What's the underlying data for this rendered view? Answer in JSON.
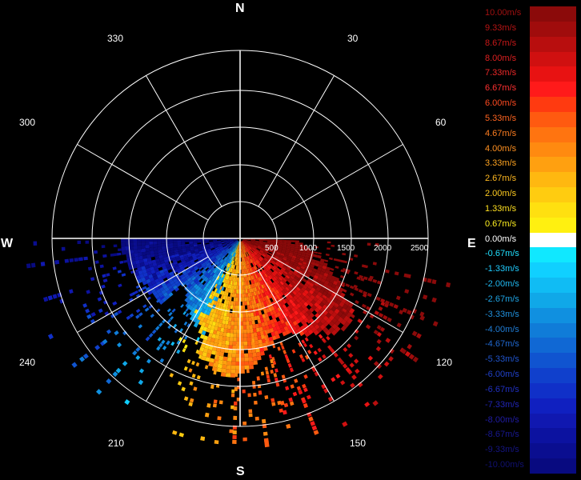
{
  "cardinals": {
    "north": "N",
    "south": "S",
    "east": "E",
    "west": "W"
  },
  "azimuth_labels": [
    "30",
    "60",
    "120",
    "150",
    "210",
    "240",
    "300",
    "330"
  ],
  "range_labels": [
    "500",
    "1000",
    "1500",
    "2000",
    "2500"
  ],
  "legend": [
    {
      "label": "10.00m/s",
      "color": "#8b0a0a",
      "text_color": "#a01010"
    },
    {
      "label": "9.33m/s",
      "color": "#a00c0c",
      "text_color": "#b81414"
    },
    {
      "label": "8.67m/s",
      "color": "#b80e0e",
      "text_color": "#c81818"
    },
    {
      "label": "8.00m/s",
      "color": "#d01010",
      "text_color": "#dd2020"
    },
    {
      "label": "7.33m/s",
      "color": "#e81212",
      "text_color": "#ee2828"
    },
    {
      "label": "6.67m/s",
      "color": "#ff1a1a",
      "text_color": "#ff3030"
    },
    {
      "label": "6.00m/s",
      "color": "#ff3a10",
      "text_color": "#ff4a20"
    },
    {
      "label": "5.33m/s",
      "color": "#ff5a10",
      "text_color": "#ff6420"
    },
    {
      "label": "4.67m/s",
      "color": "#ff7410",
      "text_color": "#ff7e20"
    },
    {
      "label": "4.00m/s",
      "color": "#ff8a10",
      "text_color": "#ff9020"
    },
    {
      "label": "3.33m/s",
      "color": "#ffa010",
      "text_color": "#ffa420"
    },
    {
      "label": "2.67m/s",
      "color": "#ffb810",
      "text_color": "#ffb820"
    },
    {
      "label": "2.00m/s",
      "color": "#ffcc10",
      "text_color": "#ffcc20"
    },
    {
      "label": "1.33m/s",
      "color": "#ffe010",
      "text_color": "#ffe020"
    },
    {
      "label": "0.67m/s",
      "color": "#fff010",
      "text_color": "#fff020"
    },
    {
      "label": "0.00m/s",
      "color": "#ffffff",
      "text_color": "#ffffff"
    },
    {
      "label": "-0.67m/s",
      "color": "#10e8ff",
      "text_color": "#20e0ff"
    },
    {
      "label": "-1.33m/s",
      "color": "#10d0ff",
      "text_color": "#20ccff"
    },
    {
      "label": "-2.00m/s",
      "color": "#10bcf4",
      "text_color": "#20b8f0"
    },
    {
      "label": "-2.67m/s",
      "color": "#10a8e8",
      "text_color": "#20a4e4"
    },
    {
      "label": "-3.33m/s",
      "color": "#1090e0",
      "text_color": "#2090dc"
    },
    {
      "label": "-4.00m/s",
      "color": "#107cd8",
      "text_color": "#207cd4"
    },
    {
      "label": "-4.67m/s",
      "color": "#1068d4",
      "text_color": "#2068d0"
    },
    {
      "label": "-5.33m/s",
      "color": "#1054d0",
      "text_color": "#2054cc"
    },
    {
      "label": "-6.00m/s",
      "color": "#1040cc",
      "text_color": "#2040c8"
    },
    {
      "label": "-6.67m/s",
      "color": "#1030c8",
      "text_color": "#2030c0"
    },
    {
      "label": "-7.33m/s",
      "color": "#1020c0",
      "text_color": "#2024b4"
    },
    {
      "label": "-8.00m/s",
      "color": "#1018b0",
      "text_color": "#201ca4"
    },
    {
      "label": "-8.67m/s",
      "color": "#0c12a0",
      "text_color": "#181890"
    },
    {
      "label": "-9.33m/s",
      "color": "#0a0e90",
      "text_color": "#141480"
    },
    {
      "label": "-10.00m/s",
      "color": "#080a80",
      "text_color": "#101070"
    }
  ]
}
